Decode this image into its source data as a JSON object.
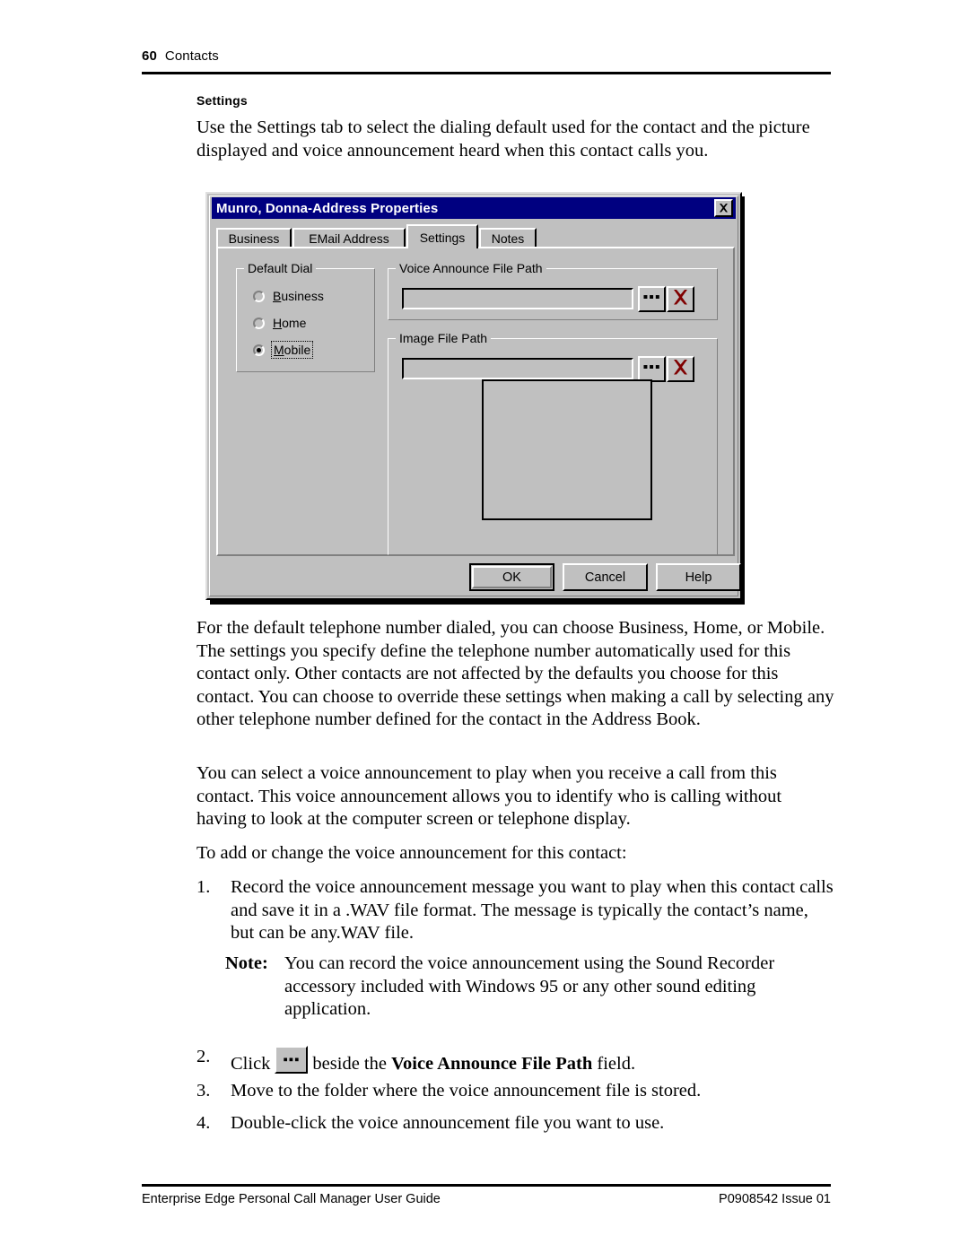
{
  "header": {
    "page_number": "60",
    "section": "Contacts"
  },
  "subhead": "Settings",
  "paragraphs": {
    "intro": "Use the Settings tab to select the dialing default used for the contact and the picture displayed and voice announcement heard when this contact calls you.",
    "after_figure": "For the default telephone number dialed, you can choose Business, Home, or Mobile. The settings you specify define the telephone number automatically used for this contact only. Other contacts are not affected by the defaults you choose for this contact. You can choose to override these settings when making a call by selecting any other telephone number defined for the contact in the Address Book.",
    "voice": "You can select a voice announcement to play when you receive a call from this contact. This voice announcement allows you to identify who is calling without having to look at the computer screen or telephone display.",
    "to_add": "To add or change the voice announcement for this contact:"
  },
  "steps": [
    {
      "number": "1.",
      "text": "Record the voice announcement message you want to play when this contact calls and save it in a .WAV file format. The message is typically the contact’s name, but can be any.WAV file."
    },
    {
      "number": "2.",
      "prefix": "Click",
      "icon": "browse-ellipsis-button",
      "middle": "beside the",
      "bold": "Voice Announce File Path",
      "suffix": "field."
    },
    {
      "number": "3.",
      "text": "Move to the folder where the voice announcement file is stored."
    },
    {
      "number": "4.",
      "text": "Double-click the voice announcement file you want to use."
    }
  ],
  "note": {
    "label": "Note:",
    "text": "You can record the voice announcement using the Sound Recorder accessory included with Windows 95 or any other sound editing application."
  },
  "dialog": {
    "title": "Munro, Donna-Address Properties",
    "close_icon": "close-icon",
    "titlebar_color": "#000080",
    "face_color": "#c0c0c0",
    "tabs": [
      {
        "label": "Business",
        "active": false
      },
      {
        "label": "EMail Address",
        "active": false
      },
      {
        "label": "Settings",
        "active": true
      },
      {
        "label": "Notes",
        "active": false
      }
    ],
    "default_dial": {
      "title": "Default Dial",
      "options": [
        {
          "label": "Business",
          "accel": "B",
          "selected": false,
          "focused": false
        },
        {
          "label": "Home",
          "accel": "H",
          "selected": false,
          "focused": false
        },
        {
          "label": "Mobile",
          "accel": "M",
          "selected": true,
          "focused": true
        }
      ]
    },
    "voice_path": {
      "title": "Voice Announce File Path",
      "value": "",
      "browse_label": "▪▪▪",
      "clear_icon": "red-x-icon",
      "clear_color": "#800000"
    },
    "image_path": {
      "title": "Image File Path",
      "value": "",
      "browse_label": "▪▪▪",
      "clear_icon": "red-x-icon",
      "clear_color": "#800000",
      "preview": ""
    },
    "buttons": {
      "ok": "OK",
      "cancel": "Cancel",
      "help": "Help"
    }
  },
  "footer": {
    "left": "Enterprise Edge Personal Call Manager User Guide",
    "right": "P0908542 Issue 01"
  }
}
